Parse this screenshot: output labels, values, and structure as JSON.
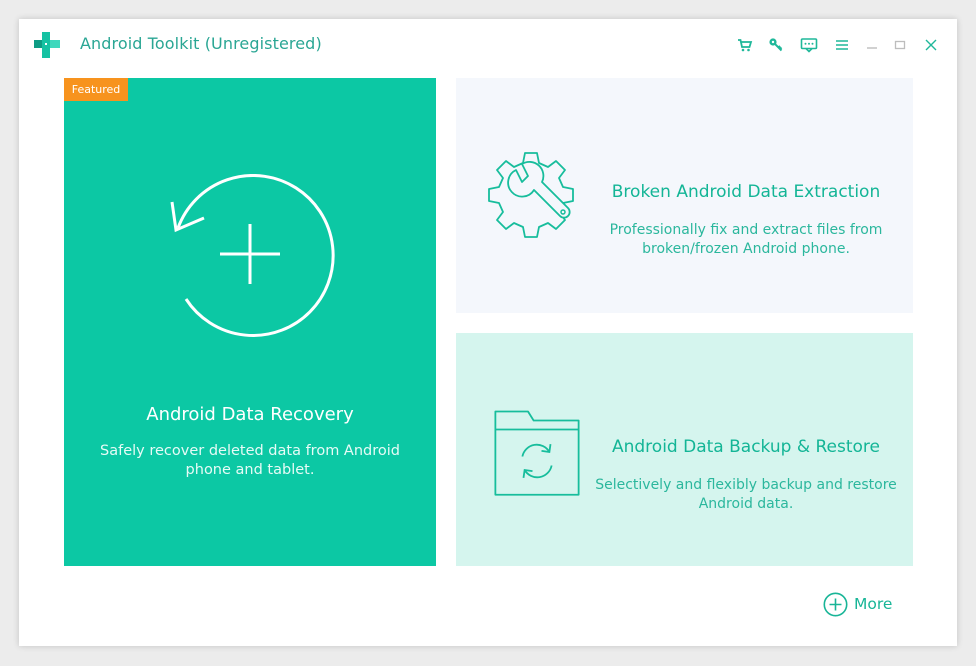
{
  "window": {
    "title": "Android Toolkit (Unregistered)"
  },
  "titlebar_icons": [
    "cart-icon",
    "key-icon",
    "feedback-icon",
    "menu-icon",
    "minimize-icon",
    "maximize-icon",
    "close-icon"
  ],
  "cards": {
    "recovery": {
      "badge": "Featured",
      "title": "Android Data Recovery",
      "description": "Safely recover deleted data from Android phone and tablet."
    },
    "extraction": {
      "title": "Broken Android Data Extraction",
      "description": "Professionally fix and extract files from broken/frozen Android phone."
    },
    "backup": {
      "title": "Android Data Backup & Restore",
      "description": "Selectively and flexibly backup and restore Android data."
    }
  },
  "more": {
    "label": "More"
  },
  "colors": {
    "accent": "#0cc8a4",
    "badge": "#f7931e",
    "text_teal": "#13b596",
    "extract_bg": "#f4f7fc",
    "backup_bg": "#d5f5ee"
  }
}
